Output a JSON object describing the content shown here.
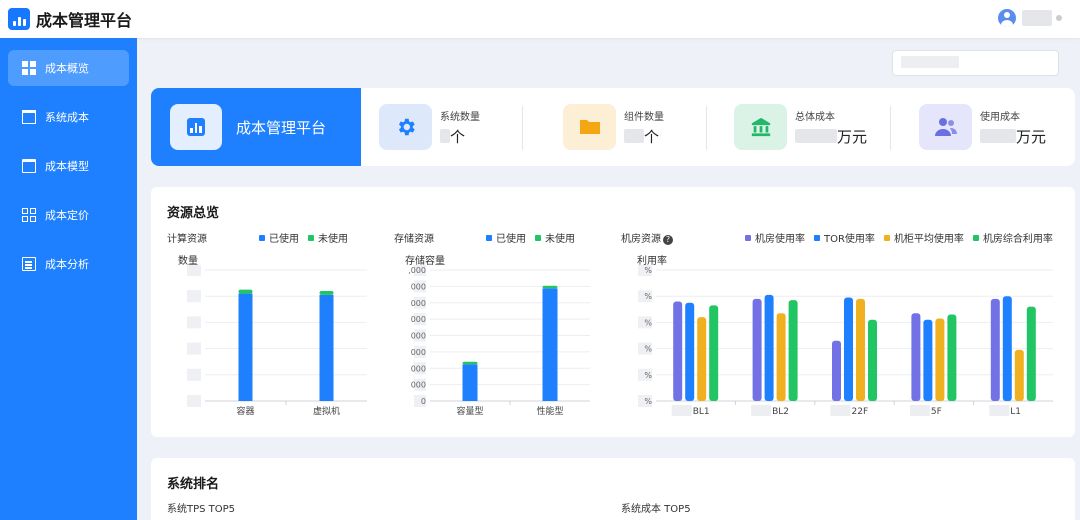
{
  "app": {
    "title": "成本管理平台"
  },
  "sidebar": {
    "items": [
      {
        "label": "成本概览",
        "icon": "dashboard-icon",
        "active": true
      },
      {
        "label": "系统成本",
        "icon": "building-icon",
        "active": false
      },
      {
        "label": "成本模型",
        "icon": "calendar-icon",
        "active": false
      },
      {
        "label": "成本定价",
        "icon": "grid-icon",
        "active": false
      },
      {
        "label": "成本分析",
        "icon": "document-icon",
        "active": false
      }
    ]
  },
  "summary": {
    "title": "成本管理平台",
    "kpis": [
      {
        "label": "系统数量",
        "value_suffix": "个",
        "icon": "gear-icon",
        "bg": "#dde9fb",
        "fg": "#1e80ff"
      },
      {
        "label": "组件数量",
        "value_suffix": "个",
        "icon": "folder-icon",
        "bg": "#fcefd6",
        "fg": "#f3a712"
      },
      {
        "label": "总体成本",
        "value_suffix": "万元",
        "icon": "bank-icon",
        "bg": "#dbf3e6",
        "fg": "#22b86a"
      },
      {
        "label": "使用成本",
        "value_suffix": "万元",
        "icon": "users-icon",
        "bg": "#e5e6fb",
        "fg": "#6b6fe0"
      }
    ]
  },
  "resource": {
    "title": "资源总览",
    "compute": {
      "name": "计算资源",
      "y_title": "数量",
      "legend": [
        {
          "name": "已使用",
          "color": "#1e80ff"
        },
        {
          "name": "未使用",
          "color": "#22c564"
        }
      ]
    },
    "storage": {
      "name": "存储资源",
      "y_title": "存储容量",
      "y_ticks": [
        "0",
        "000",
        "000",
        "000",
        "000",
        "000",
        "000",
        "000",
        ",000"
      ],
      "legend": [
        {
          "name": "已使用",
          "color": "#1e80ff"
        },
        {
          "name": "未使用",
          "color": "#22c564"
        }
      ]
    },
    "room": {
      "name": "机房资源",
      "y_title": "利用率",
      "y_ticks": [
        "%",
        "%",
        "%",
        "%",
        "%",
        "%"
      ],
      "legend": [
        {
          "name": "机房使用率",
          "color": "#7272e6"
        },
        {
          "name": "TOR使用率",
          "color": "#1e80ff"
        },
        {
          "name": "机柜平均使用率",
          "color": "#f0b020"
        },
        {
          "name": "机房综合利用率",
          "color": "#22c564"
        }
      ]
    }
  },
  "chart_data": [
    {
      "type": "bar",
      "title": "计算资源",
      "ylabel": "数量",
      "categories": [
        "容器",
        "虚拟机"
      ],
      "series": [
        {
          "name": "已使用",
          "values": [
            82,
            81
          ]
        },
        {
          "name": "未使用",
          "values": [
            3,
            3
          ]
        }
      ],
      "ylim": [
        0,
        100
      ]
    },
    {
      "type": "bar",
      "title": "存储资源",
      "ylabel": "存储容量",
      "categories": [
        "容量型",
        "性能型"
      ],
      "series": [
        {
          "name": "已使用",
          "values": [
            28,
            86
          ]
        },
        {
          "name": "未使用",
          "values": [
            2,
            2
          ]
        }
      ],
      "ylim": [
        0,
        100
      ]
    },
    {
      "type": "bar",
      "title": "机房资源",
      "ylabel": "利用率",
      "categories": [
        "BL1",
        "BL2",
        "22F",
        "5F",
        "L1"
      ],
      "series": [
        {
          "name": "机房使用率",
          "values": [
            76,
            78,
            46,
            67,
            78
          ]
        },
        {
          "name": "TOR使用率",
          "values": [
            75,
            81,
            79,
            62,
            80
          ]
        },
        {
          "name": "机柜平均使用率",
          "values": [
            64,
            67,
            78,
            63,
            39
          ]
        },
        {
          "name": "机房综合利用率",
          "values": [
            73,
            77,
            62,
            66,
            72
          ]
        }
      ],
      "ylim": [
        0,
        100
      ]
    }
  ],
  "ranking": {
    "title": "系统排名",
    "left": "系统TPS TOP5",
    "right": "系统成本 TOP5"
  }
}
